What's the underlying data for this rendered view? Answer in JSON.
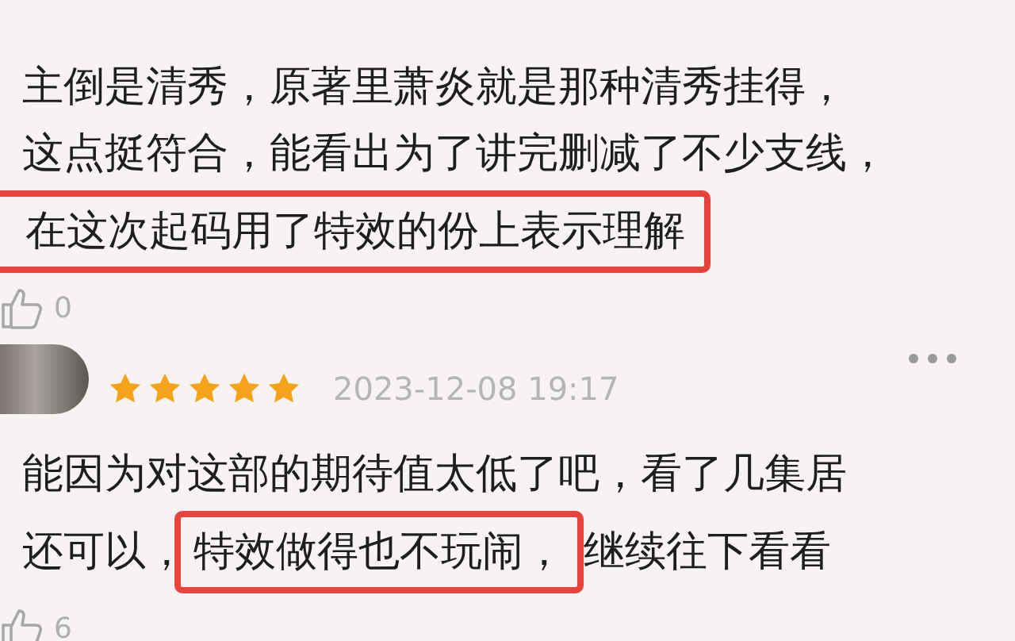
{
  "reviews": [
    {
      "lines": [
        [
          {
            "text": "主倒是清秀，原著里萧炎就是那种清秀挂得，",
            "highlighted": false
          }
        ],
        [
          {
            "text": "这点挺符合，能看出为了讲完删减了不少支线，",
            "highlighted": false
          }
        ],
        [
          {
            "text": "在这次起码用了特效的份上表示理解",
            "highlighted": true
          }
        ]
      ],
      "likes": "0"
    },
    {
      "stars": 5,
      "date": "2023-12-08 19:17",
      "lines": [
        [
          {
            "text": "能因为对这部的期待值太低了吧，看了几集居",
            "highlighted": false
          }
        ],
        [
          {
            "text": "还可以，",
            "highlighted": false
          },
          {
            "text": "特效做得也不玩闹，",
            "highlighted": true
          },
          {
            "text": "继续往下看看",
            "highlighted": false
          }
        ]
      ],
      "likes": "6"
    }
  ]
}
